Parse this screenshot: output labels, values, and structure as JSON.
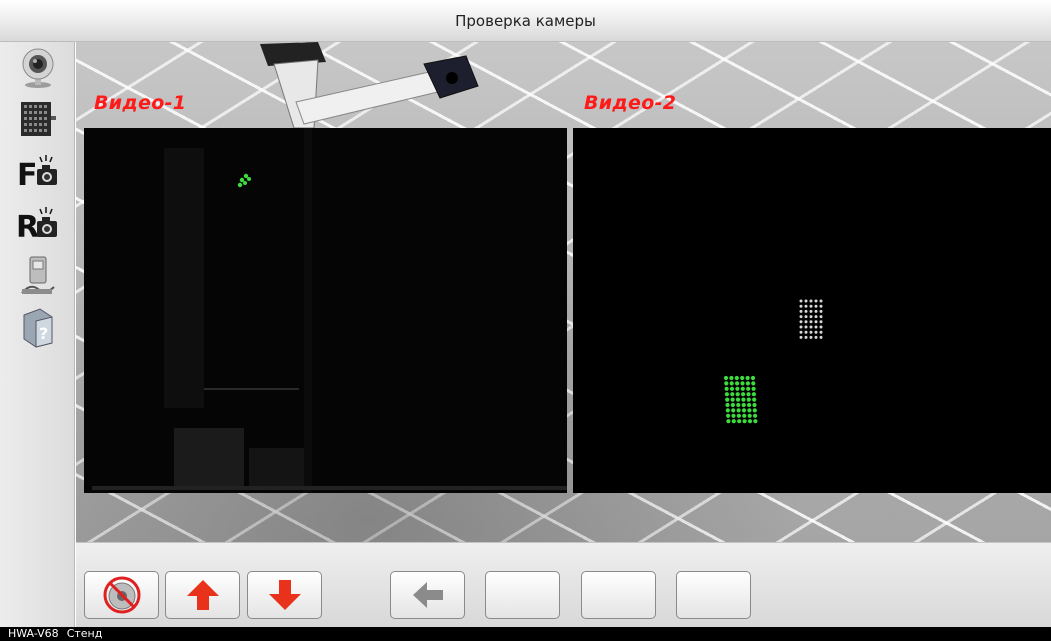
{
  "window": {
    "title": "Проверка камеры"
  },
  "sidebar": {
    "items": [
      {
        "name": "webcam",
        "icon": "webcam-icon"
      },
      {
        "name": "target-panel",
        "icon": "target-grid-icon"
      },
      {
        "name": "front-camera",
        "icon": "front-camera-icon",
        "letter": "F"
      },
      {
        "name": "rear-camera",
        "icon": "rear-camera-icon",
        "letter": "R"
      },
      {
        "name": "sensor-tool",
        "icon": "sensor-device-icon"
      },
      {
        "name": "help",
        "icon": "help-book-icon"
      }
    ]
  },
  "viewport": {
    "video1_label": "Видео-1",
    "video2_label": "Видео-2"
  },
  "bottombar": {
    "buttons": [
      {
        "name": "disable-camera",
        "icon": "no-camera-icon"
      },
      {
        "name": "move-up",
        "icon": "arrow-up-icon"
      },
      {
        "name": "move-down",
        "icon": "arrow-down-icon"
      },
      {
        "name": "back",
        "icon": "arrow-left-icon"
      },
      {
        "name": "empty-1",
        "icon": ""
      },
      {
        "name": "empty-2",
        "icon": ""
      },
      {
        "name": "empty-3",
        "icon": ""
      }
    ]
  },
  "status": {
    "model": "HWA-V68",
    "mode": "Стенд"
  },
  "colors": {
    "label_red": "#ff1a1a",
    "arrow_red": "#e8321b",
    "dot_green": "#3ddc3d"
  }
}
